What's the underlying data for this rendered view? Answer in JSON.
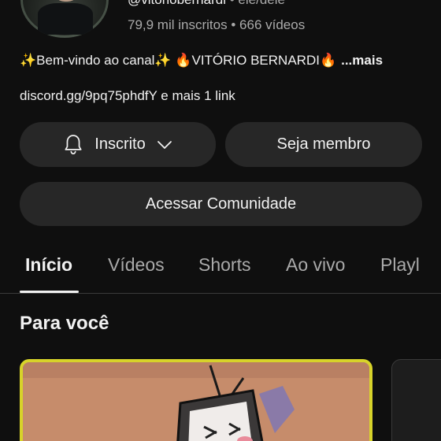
{
  "channel": {
    "handle": "@vitoriobernardi",
    "pronouns": "ele/dele",
    "separator": "•",
    "subscribers": "79,9 mil inscritos",
    "videos": "666 vídeos",
    "description": "✨Bem-vindo ao canal✨  🔥VITÓRIO BERNARDI🔥",
    "more_label": "...mais",
    "link": "discord.gg/9pq75phdfY",
    "link_extra": "e mais 1 link"
  },
  "actions": {
    "subscribed_label": "Inscrito",
    "member_label": "Seja membro",
    "community_label": "Acessar Comunidade"
  },
  "tabs": [
    {
      "label": "Início",
      "active": true
    },
    {
      "label": "Vídeos",
      "active": false
    },
    {
      "label": "Shorts",
      "active": false
    },
    {
      "label": "Ao vivo",
      "active": false
    },
    {
      "label": "Playl",
      "active": false
    }
  ],
  "feed": {
    "section_title": "Para você"
  },
  "colors": {
    "background": "#0f0f0f",
    "button_bg": "#272727",
    "thumbnail_border": "#d7d32a"
  }
}
